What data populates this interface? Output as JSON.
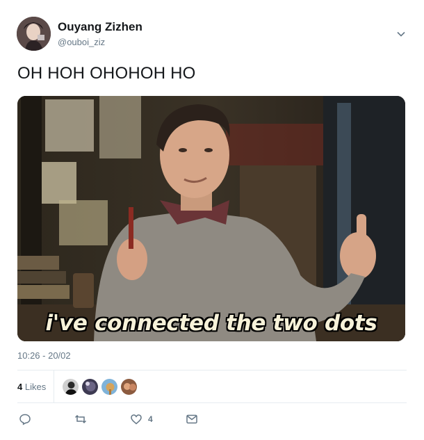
{
  "user": {
    "display_name": "Ouyang Zizhen",
    "handle": "@ouboi_ziz"
  },
  "tweet": {
    "text": "OH HOH OHOHOH HO",
    "media_caption": "i've connected the two dots",
    "timestamp": "10:26 - 20/02"
  },
  "stats": {
    "likes_number": "4",
    "likes_label": "Likes",
    "liker_avatars": [
      "liker-1",
      "liker-2",
      "liker-3",
      "liker-4"
    ]
  },
  "actions": {
    "reply_icon": "reply-icon",
    "retweet_icon": "retweet-icon",
    "like_icon": "heart-icon",
    "like_count": "4",
    "dm_icon": "mail-icon"
  },
  "colors": {
    "text_primary": "#14171a",
    "text_secondary": "#657786",
    "divider": "#e6ecf0",
    "icon": "#657786"
  }
}
